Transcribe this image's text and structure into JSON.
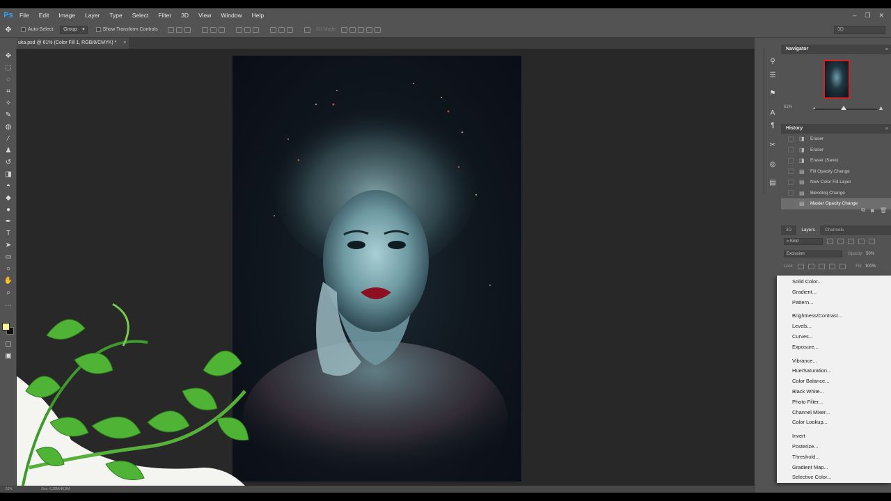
{
  "app": {
    "logo": "Ps"
  },
  "menu": [
    "File",
    "Edit",
    "Image",
    "Layer",
    "Type",
    "Select",
    "Filter",
    "3D",
    "View",
    "Window",
    "Help"
  ],
  "window_controls": {
    "minimize": "–",
    "restore": "❐",
    "close": "✕"
  },
  "options_bar": {
    "auto_select_label": "Auto-Select:",
    "auto_select_value": "Group",
    "transform_label": "Show Transform Controls",
    "mode_3d_label": "3D Mode:",
    "workspace_value": "3D"
  },
  "document": {
    "tab_label": "uka.psd @ 61% (Color Fill 1, RGB/8/CMYK) *",
    "tab_close": "×"
  },
  "status": {
    "zoom": "61%",
    "doc": "Doc: 6,38M/48,9M"
  },
  "navigator": {
    "title": "Navigator",
    "zoom": "61%"
  },
  "history": {
    "title": "History",
    "items": [
      "Eraser",
      "Eraser",
      "Eraser (Save)",
      "Fill Opacity Change",
      "New Color Fill Layer",
      "Blending Change",
      "Master Opacity Change"
    ],
    "active_index": 6
  },
  "layers": {
    "tabs": [
      "3D",
      "Layers",
      "Channels"
    ],
    "kind_label": "Kind",
    "blend_mode": "Exclusion",
    "opacity_label": "Opacity:",
    "opacity_value": "50%",
    "lock_label": "Lock:",
    "fill_label": "Fill:",
    "fill_value": "100%"
  },
  "adjustment_menu": {
    "groups": [
      [
        "Solid Color...",
        "Gradient...",
        "Pattern..."
      ],
      [
        "Brightness/Contrast...",
        "Levels...",
        "Curves...",
        "Exposure..."
      ],
      [
        "Vibrance...",
        "Hue/Saturation...",
        "Color Balance...",
        "Black  White...",
        "Photo Filter...",
        "Channel Mixer...",
        "Color Lookup..."
      ],
      [
        "Invert",
        "Posterize...",
        "Threshold...",
        "Gradient Map...",
        "Selective Color..."
      ]
    ]
  },
  "colors": {
    "foreground": "#f4f39a",
    "background": "#111111",
    "accent": "#31a8ff",
    "panel": "#535353"
  }
}
